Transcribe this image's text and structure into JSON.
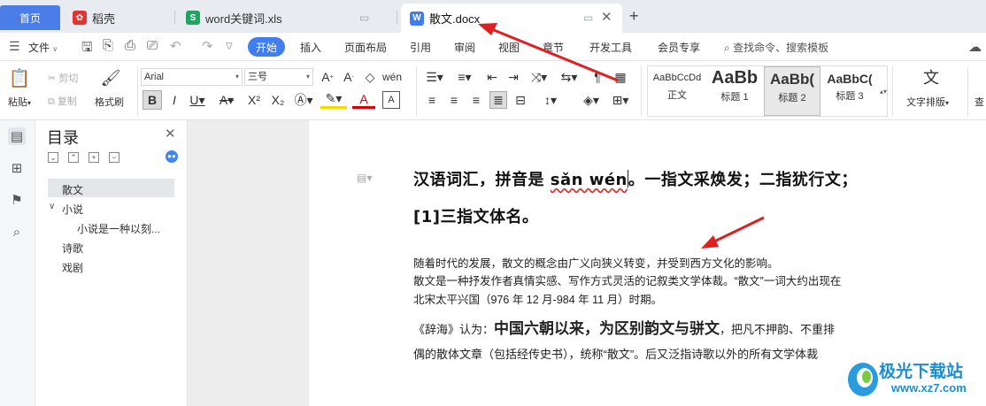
{
  "tabs": {
    "home": "首页",
    "daoke": "稻壳",
    "xls": "word关键词.xls",
    "docx": "散文.docx"
  },
  "menu": {
    "file": "文件",
    "start": "开始",
    "items": [
      "插入",
      "页面布局",
      "引用",
      "审阅",
      "视图",
      "章节",
      "开发工具",
      "会员专享"
    ],
    "search": "查找命令、搜索模板"
  },
  "ribbon": {
    "paste": "粘贴",
    "cut": "剪切",
    "copy": "复制",
    "format_painter": "格式刷",
    "font": "Arial",
    "size": "三号",
    "styles": [
      {
        "sample": "AaBbCcDd",
        "name": "正文"
      },
      {
        "sample": "AaBb",
        "name": "标题 1"
      },
      {
        "sample": "AaBb(",
        "name": "标题 2"
      },
      {
        "sample": "AaBbC(",
        "name": "标题 3"
      }
    ],
    "text_layout": "文字排版"
  },
  "toc": {
    "title": "目录",
    "items": [
      "散文",
      "小说",
      "小说是一种以刻...",
      "诗歌",
      "戏剧"
    ]
  },
  "document": {
    "h1_a": "汉语词汇，拼音是 ",
    "h1_pinyin": "sǎn wén",
    "h1_b": "。一指文采焕发；二指犹行文；",
    "h2": "[1]三指文体名。",
    "p1": "随着时代的发展，散文的概念由广义向狭义转变，并受到西方文化的影响。",
    "p2": "散文是一种抒发作者真情实感、写作方式灵活的记叙类文学体裁。“散文”一词大约出现在",
    "p3": "北宋太平兴国（976 年 12 月-984 年 11 月）时期。",
    "p4_a": "《辞海》认为：",
    "p4_bold": "中国六朝以来，为区别韵文与骈文",
    "p4_b": "，把凡不押韵、不重排",
    "p5": "偶的散体文章（包括经传史书），统称“散文”。后又泛指诗歌以外的所有文学体裁"
  },
  "watermark": {
    "name": "极光下载站",
    "url": "www.xz7.com"
  },
  "colors": {
    "accent": "#3f7df0",
    "arrow": "#e02020"
  }
}
